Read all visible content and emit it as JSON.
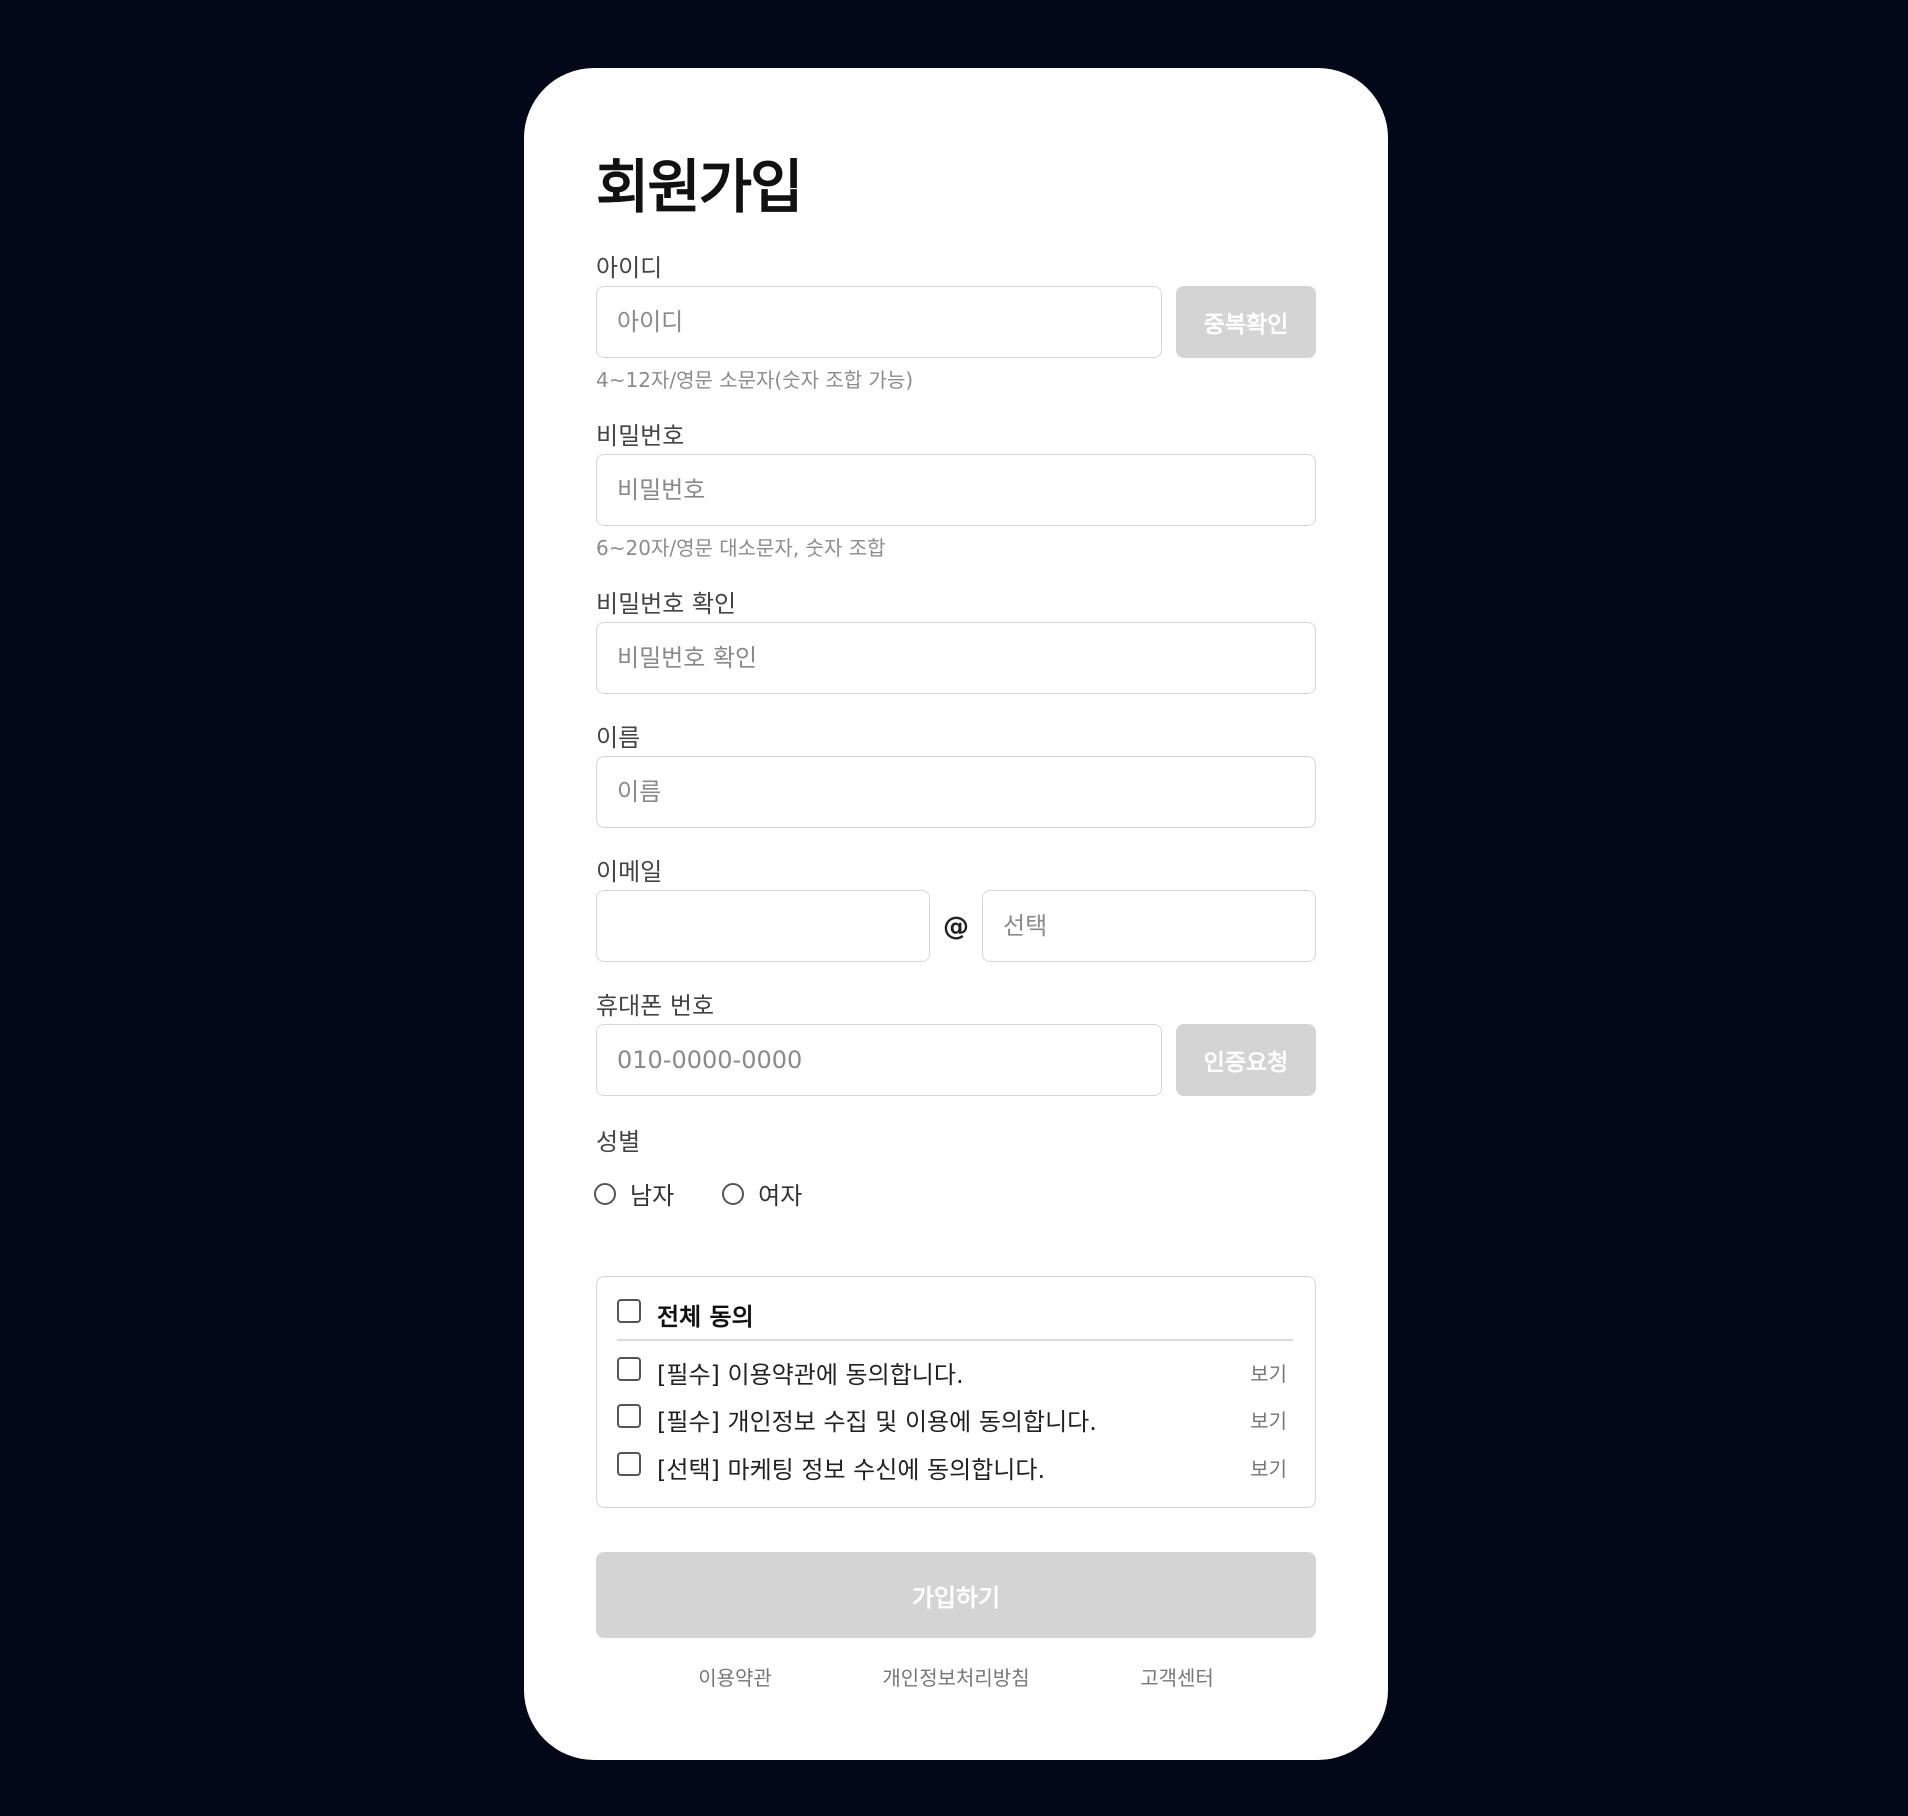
{
  "signup": {
    "title": "회원가입",
    "id": {
      "label": "아이디",
      "placeholder": "아이디",
      "check_button": "중복확인",
      "hint": "4~12자/영문 소문자(숫자 조합 가능)"
    },
    "password": {
      "label": "비밀번호",
      "placeholder": "비밀번호",
      "hint": "6~20자/영문 대소문자, 숫자 조합"
    },
    "password_confirm": {
      "label": "비밀번호 확인",
      "placeholder": "비밀번호 확인"
    },
    "name": {
      "label": "이름",
      "placeholder": "이름"
    },
    "email": {
      "label": "이메일",
      "local_value": "",
      "at_symbol": "@",
      "domain_placeholder": "선택"
    },
    "phone": {
      "label": "휴대폰 번호",
      "placeholder": "010-0000-0000",
      "verify_button": "인증요청"
    },
    "gender": {
      "label": "성별",
      "options": [
        "남자",
        "여자"
      ]
    },
    "agreements": {
      "all_label": "전체 동의",
      "items": [
        {
          "label": "[필수] 이용약관에 동의합니다.",
          "view": "보기"
        },
        {
          "label": "[필수] 개인정보 수집 및 이용에 동의합니다.",
          "view": "보기"
        },
        {
          "label": "[선택] 마케팅 정보 수신에 동의합니다.",
          "view": "보기"
        }
      ]
    },
    "submit_label": "가입하기",
    "footer_links": [
      "이용약관",
      "개인정보처리방침",
      "고객센터"
    ]
  },
  "colors": {
    "background": "#020817",
    "card": "#ffffff",
    "disabled_button": "#d4d4d4",
    "border": "#d6d6d6"
  }
}
